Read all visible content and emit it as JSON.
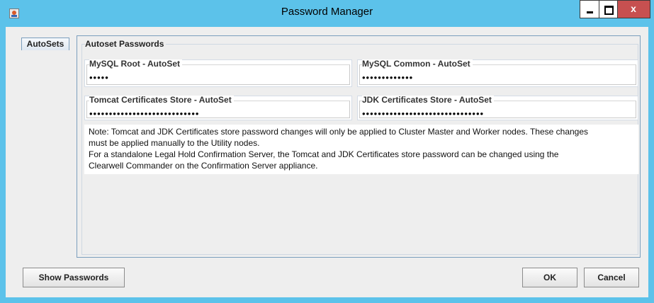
{
  "window": {
    "title": "Password Manager"
  },
  "tabs": [
    {
      "label": "AutoSets"
    }
  ],
  "group": {
    "title": "Autoset Passwords",
    "fields": [
      {
        "label": "MySQL Root - AutoSet",
        "value": "•••••"
      },
      {
        "label": "MySQL Common - AutoSet",
        "value": "•••••••••••••"
      },
      {
        "label": "Tomcat Certificates Store - AutoSet",
        "value": "••••••••••••••••••••••••••••"
      },
      {
        "label": "JDK Certificates Store - AutoSet",
        "value": "•••••••••••••••••••••••••••••••"
      }
    ]
  },
  "note": {
    "line1": "Note: Tomcat and JDK Certificates store password changes will only be applied to Cluster Master and Worker nodes. These changes",
    "line2": "must be applied manually to the Utility nodes.",
    "line3": "For a standalone Legal Hold Confirmation Server, the Tomcat and JDK Certificates store password can be changed using the",
    "line4": "Clearwell Commander on the Confirmation Server appliance."
  },
  "buttons": {
    "show_passwords": "Show Passwords",
    "ok": "OK",
    "cancel": "Cancel"
  },
  "controls": {
    "close_glyph": "x"
  }
}
